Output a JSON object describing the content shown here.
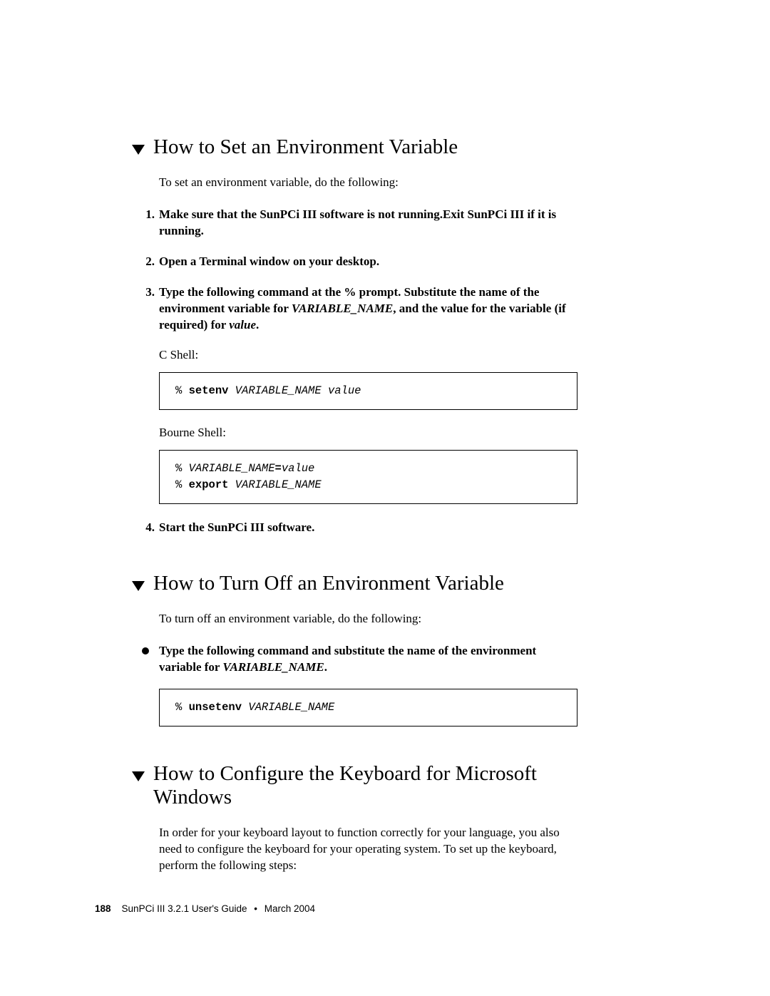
{
  "section1": {
    "heading": "How to Set an Environment Variable",
    "intro": "To set an environment variable, do the following:",
    "steps": {
      "s1": {
        "num": "1.",
        "text": "Make sure that the SunPCi III software is not running.Exit SunPCi III if it is running."
      },
      "s2": {
        "num": "2.",
        "text": "Open a Terminal window on your desktop."
      },
      "s3": {
        "num": "3.",
        "text_a": "Type the following command at the % prompt. Substitute the name of the environment variable for ",
        "var1": "VARIABLE_NAME",
        "text_b": ", and the value for the variable (if required) for ",
        "var2": "value",
        "text_c": "."
      },
      "s4": {
        "num": "4.",
        "text": "Start the SunPCi III software."
      }
    },
    "shell1_label": "C Shell:",
    "shell1_code": {
      "prompt": "% ",
      "cmd": "setenv",
      "args": " VARIABLE_NAME value"
    },
    "shell2_label": "Bourne Shell:",
    "shell2_code": {
      "line1_prompt": "% ",
      "line1_var": "VARIABLE_NAME",
      "line1_eq": "=",
      "line1_val": "value",
      "line2_prompt": "% ",
      "line2_cmd": "export",
      "line2_var": " VARIABLE_NAME"
    }
  },
  "section2": {
    "heading": "How to Turn Off an Environment Variable",
    "intro": "To turn off an environment variable, do the following:",
    "bullet": {
      "text_a": "Type the following command and substitute the name of the environment variable for ",
      "var1": "VARIABLE_NAME",
      "text_b": "."
    },
    "code": {
      "prompt": "% ",
      "cmd": "unsetenv",
      "args": " VARIABLE_NAME"
    }
  },
  "section3": {
    "heading": "How to Configure the Keyboard for Microsoft Windows",
    "intro": "In order for your keyboard layout to function correctly for your language, you also need to configure the keyboard for your operating system. To set up the keyboard, perform the following steps:"
  },
  "footer": {
    "page": "188",
    "title": "SunPCi III 3.2.1 User's Guide",
    "sep": "•",
    "date": "March 2004"
  }
}
